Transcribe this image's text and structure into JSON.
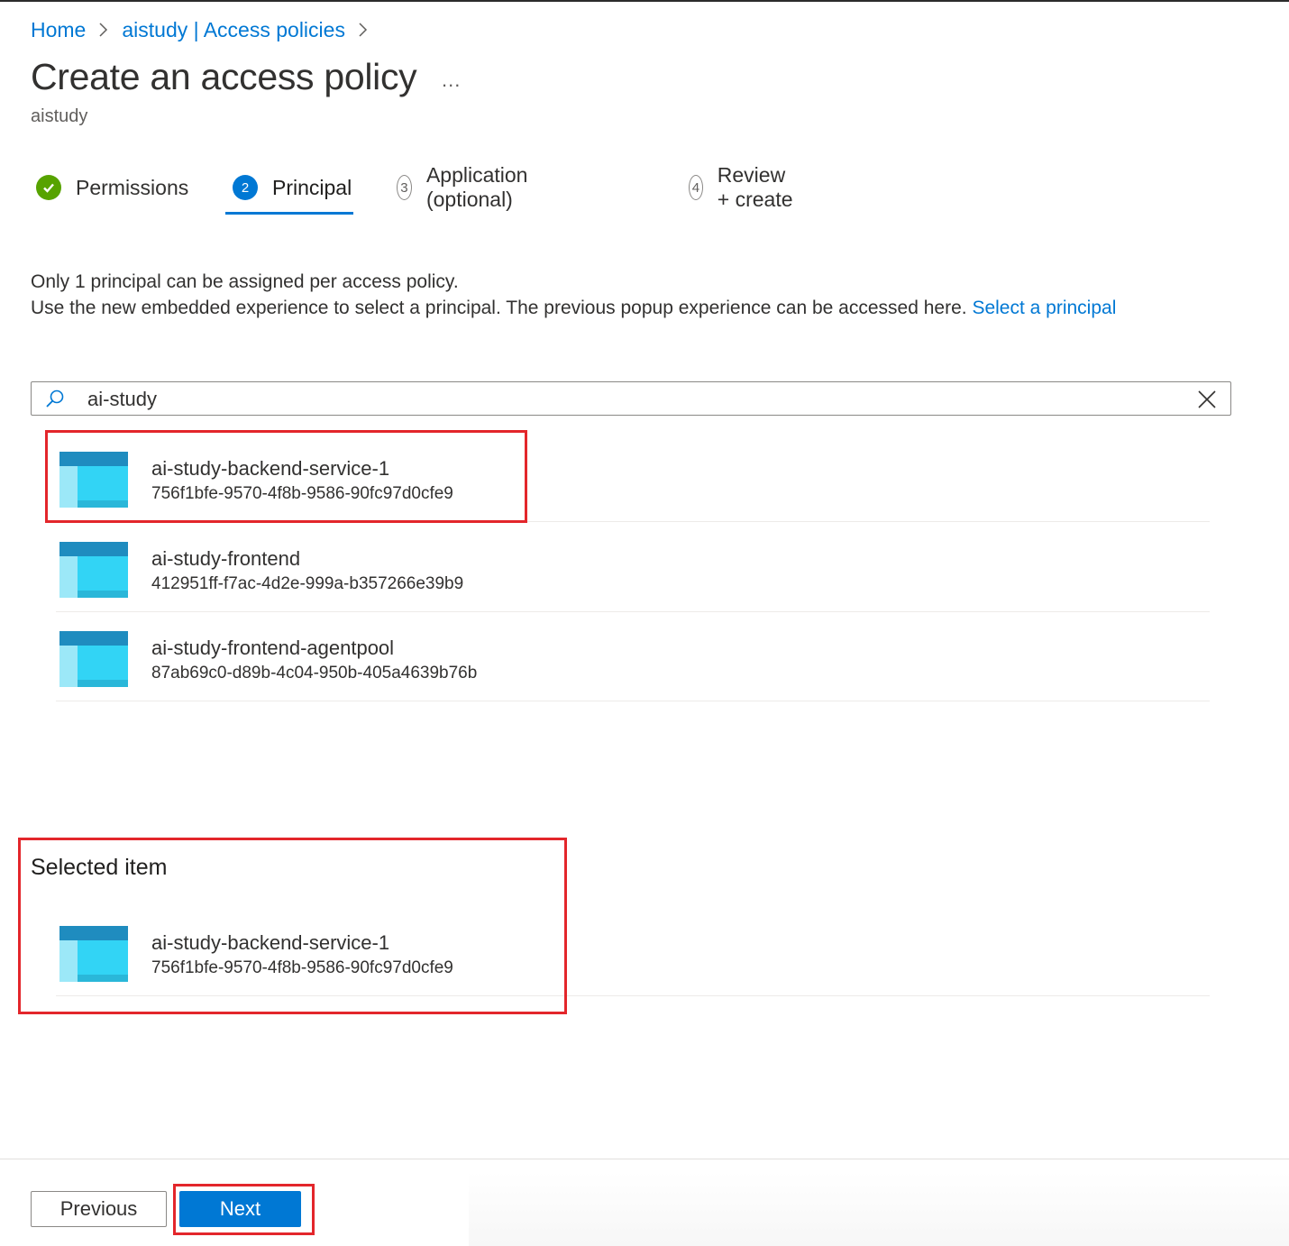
{
  "breadcrumb": {
    "items": [
      "Home",
      "aistudy | Access policies"
    ]
  },
  "page": {
    "title": "Create an access policy",
    "subtitle": "aistudy",
    "more_label": "..."
  },
  "wizard": {
    "steps": [
      {
        "number": "1",
        "label": "Permissions",
        "state": "complete"
      },
      {
        "number": "2",
        "label": "Principal",
        "state": "active"
      },
      {
        "number": "3",
        "label": "Application (optional)",
        "state": "pending"
      },
      {
        "number": "4",
        "label": "Review + create",
        "state": "pending"
      }
    ]
  },
  "info": {
    "line1": "Only 1 principal can be assigned per access policy.",
    "line2": "Use the new embedded experience to select a principal. The previous popup experience can be accessed here.",
    "link": "Select a principal"
  },
  "search": {
    "value": "ai-study"
  },
  "results": [
    {
      "name": "ai-study-backend-service-1",
      "id": "756f1bfe-9570-4f8b-9586-90fc97d0cfe9"
    },
    {
      "name": "ai-study-frontend",
      "id": "412951ff-f7ac-4d2e-999a-b357266e39b9"
    },
    {
      "name": "ai-study-frontend-agentpool",
      "id": "87ab69c0-d89b-4c04-950b-405a4639b76b"
    }
  ],
  "selected": {
    "heading": "Selected item",
    "name": "ai-study-backend-service-1",
    "id": "756f1bfe-9570-4f8b-9586-90fc97d0cfe9"
  },
  "footer": {
    "previous_label": "Previous",
    "next_label": "Next"
  },
  "colors": {
    "accent": "#0078d4",
    "complete": "#57a300",
    "highlight": "#e3262b"
  }
}
